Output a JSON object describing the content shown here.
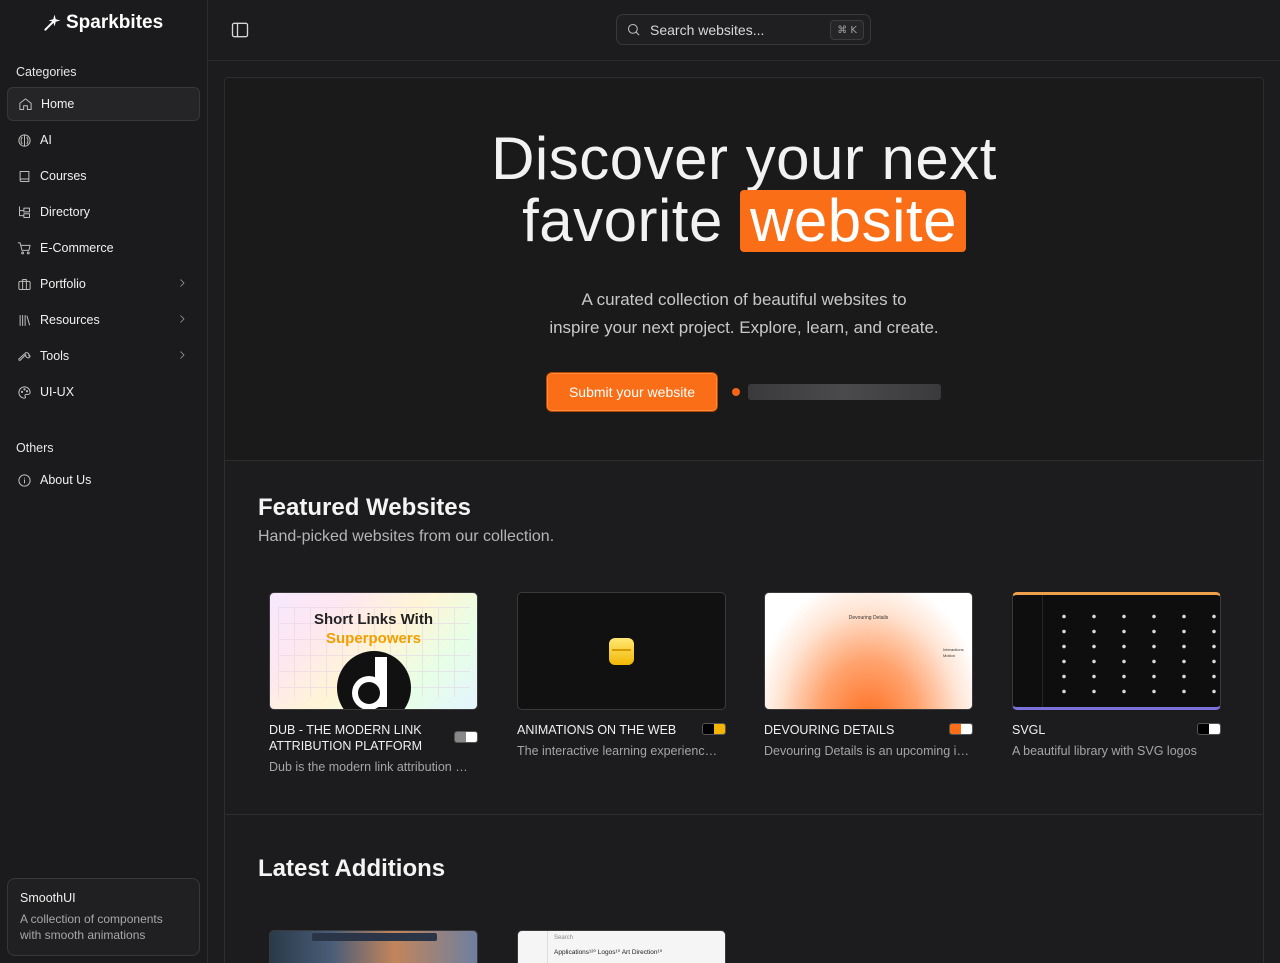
{
  "brand": {
    "name": "Sparkbites"
  },
  "sidebar": {
    "categories_label": "Categories",
    "items": [
      {
        "label": "Home",
        "icon": "home-icon",
        "active": true
      },
      {
        "label": "AI",
        "icon": "brain-icon"
      },
      {
        "label": "Courses",
        "icon": "book-icon"
      },
      {
        "label": "Directory",
        "icon": "folder-tree-icon"
      },
      {
        "label": "E-Commerce",
        "icon": "cart-icon"
      },
      {
        "label": "Portfolio",
        "icon": "briefcase-icon",
        "chevron": true
      },
      {
        "label": "Resources",
        "icon": "library-icon",
        "chevron": true
      },
      {
        "label": "Tools",
        "icon": "wrench-icon",
        "chevron": true
      },
      {
        "label": "UI-UX",
        "icon": "palette-icon"
      }
    ],
    "others_label": "Others",
    "others": [
      {
        "label": "About Us",
        "icon": "info-icon"
      }
    ],
    "promo": {
      "title": "SmoothUI",
      "description": "A collection of components with smooth animations"
    }
  },
  "search": {
    "placeholder": "Search websites...",
    "shortcut": "⌘ K"
  },
  "hero": {
    "line1": "Discover your next",
    "line2_prefix": "favorite",
    "highlight": "website",
    "subtitle_line1": "A curated collection of beautiful websites to",
    "subtitle_line2": "inspire your next project. Explore, learn, and create.",
    "cta": "Submit your website",
    "accent": "#f96e16"
  },
  "featured": {
    "title": "Featured Websites",
    "subtitle": "Hand-picked websites from our collection.",
    "cards": [
      {
        "title": "DUB - THE MODERN LINK ATTRIBUTION PLATFORM",
        "description": "Dub is the modern link attribution pl...",
        "thumb_line1": "Short Links With",
        "thumb_line2": "Superpowers",
        "colors": [
          "#888888",
          "#ffffff"
        ]
      },
      {
        "title": "ANIMATIONS ON THE WEB",
        "description": "The interactive learning experience t...",
        "colors": [
          "#000000",
          "#f4b400"
        ]
      },
      {
        "title": "DEVOURING DETAILS",
        "description": "Devouring Details is an upcoming int...",
        "thumb_label": "Devouring Details",
        "thumb_side": "Interactions Motion",
        "colors": [
          "#f96e16",
          "#ffffff"
        ]
      },
      {
        "title": "SVGL",
        "description": "A beautiful library with SVG logos",
        "colors": [
          "#000000",
          "#ffffff"
        ]
      }
    ]
  },
  "latest": {
    "title": "Latest Additions",
    "thumb2_search": "Search",
    "thumb2_tabs": "Applications¹²⁰  Logos¹⁰  Art Direction¹⁰"
  }
}
